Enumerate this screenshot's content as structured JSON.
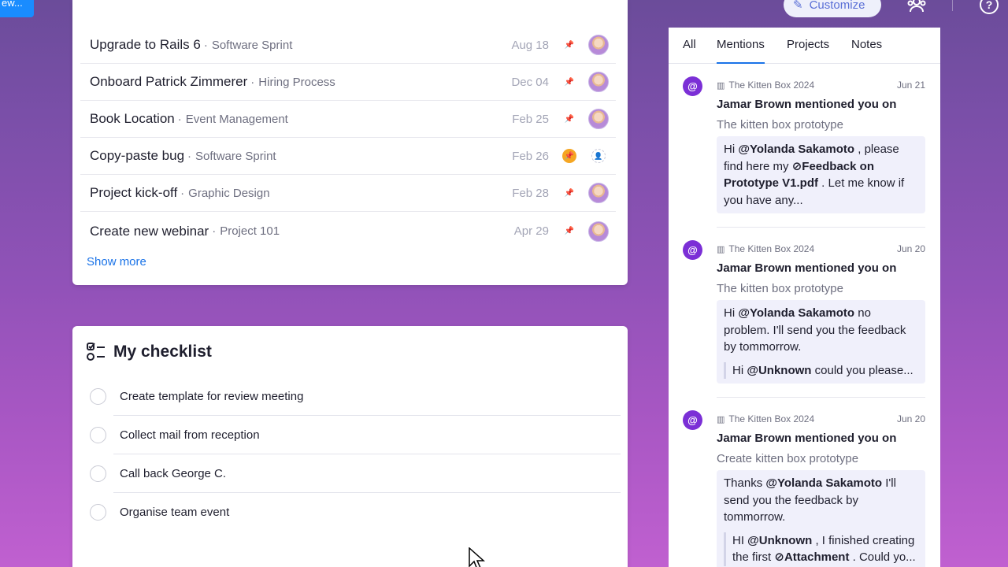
{
  "topbar": {
    "new_label": "ew...",
    "customize_label": "Customize"
  },
  "tasks": {
    "rows": [
      {
        "title": "Upgrade to Rails 6",
        "project": "Software Sprint",
        "date": "Aug 18",
        "pinned": false,
        "assigned": true
      },
      {
        "title": "Onboard Patrick Zimmerer",
        "project": "Hiring Process",
        "date": "Dec 04",
        "pinned": false,
        "assigned": true
      },
      {
        "title": "Book Location",
        "project": "Event Management",
        "date": "Feb 25",
        "pinned": false,
        "assigned": true
      },
      {
        "title": "Copy-paste bug",
        "project": "Software Sprint",
        "date": "Feb 26",
        "pinned": true,
        "assigned": false
      },
      {
        "title": "Project kick-off",
        "project": "Graphic Design",
        "date": "Feb 28",
        "pinned": false,
        "assigned": true
      },
      {
        "title": "Create new webinar",
        "project": "Project 101",
        "date": "Apr 29",
        "pinned": false,
        "assigned": true
      }
    ],
    "show_more": "Show more"
  },
  "checklist": {
    "title": "My checklist",
    "items": [
      "Create template for review meeting",
      "Collect mail from reception",
      "Call back George C.",
      "Organise team event"
    ]
  },
  "inbox": {
    "tabs": [
      "All",
      "Mentions",
      "Projects",
      "Notes"
    ],
    "active_tab": "Mentions",
    "mentions": [
      {
        "board": "The Kitten Box 2024",
        "date": "Jun 21",
        "who": "Jamar Brown mentioned you on",
        "item": "The kitten box prototype",
        "m1_pre": "Hi ",
        "m1_user": "@Yolanda Sakamoto",
        "m1_mid": " , please find here my ",
        "m1_file": "Feedback on Prototype V1.pdf",
        "m1_post": " . Let me know if you have any..."
      },
      {
        "board": "The Kitten Box 2024",
        "date": "Jun 20",
        "who": "Jamar Brown mentioned you on",
        "item": "The kitten box prototype",
        "m2_pre": "Hi ",
        "m2_user": "@Yolanda Sakamoto",
        "m2_post": " no problem. I'll send you the feedback by tommorrow.",
        "q_pre": "Hi ",
        "q_user": "@Unknown",
        "q_post": " could you please..."
      },
      {
        "board": "The Kitten Box 2024",
        "date": "Jun 20",
        "who": "Jamar Brown mentioned you on",
        "item": "Create kitten box prototype",
        "m3_pre": "Thanks ",
        "m3_user": "@Yolanda Sakamoto",
        "m3_post": " I'll send you the feedback by tommorrow.",
        "q_pre": "HI ",
        "q_user": "@Unknown",
        "q_mid": " , I finished creating the first ",
        "q_file": "Attachment",
        "q_post": " . Could yo..."
      }
    ]
  },
  "colors": {
    "accent": "#1a73e8",
    "mention_badge": "#7b2fd6",
    "pin_active": "#f5a623"
  }
}
